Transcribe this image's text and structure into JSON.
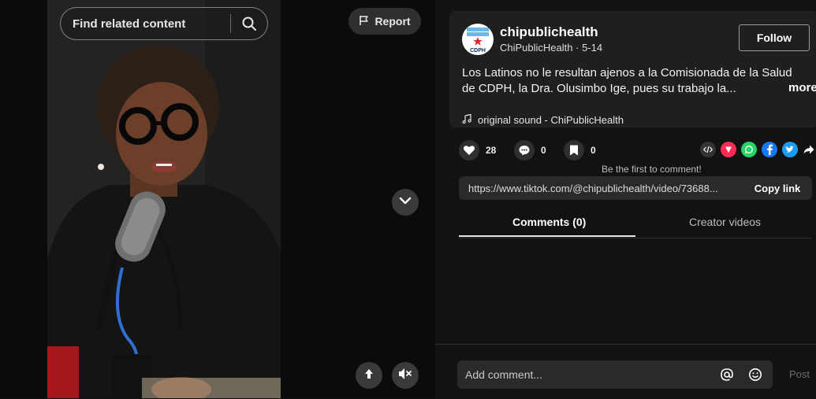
{
  "search": {
    "placeholder": "Find related content"
  },
  "report_label": "Report",
  "post": {
    "username": "chipublichealth",
    "display_name": "ChiPublicHealth",
    "date": "5-14",
    "follow_label": "Follow",
    "description": "Los Latinos no le resultan ajenos a la Comisionada de la Salud de CDPH, la Dra. Olusimbo Ige, pues su trabajo la...",
    "more_label": "more",
    "sound": "original sound - ChiPublicHealth",
    "avatar_text": "CDPH"
  },
  "stats": {
    "likes": "28",
    "comments": "0",
    "saves": "0"
  },
  "first_comment_hint": "Be the first to comment!",
  "share": {
    "link": "https://www.tiktok.com/@chipublichealth/video/73688...",
    "copy_label": "Copy link",
    "icons": [
      "embed-icon",
      "repost-icon",
      "whatsapp-icon",
      "facebook-icon",
      "twitter-icon",
      "share-arrow-icon"
    ]
  },
  "tabs": [
    {
      "label": "Comments (0)",
      "active": true
    },
    {
      "label": "Creator videos",
      "active": false
    }
  ],
  "comment": {
    "placeholder": "Add comment...",
    "post_label": "Post"
  },
  "colors": {
    "background": "#121212",
    "card": "#1f1f1f",
    "repost": "#fe2c55",
    "whatsapp": "#25d366",
    "facebook": "#1877f2",
    "twitter": "#1d9bf0"
  }
}
